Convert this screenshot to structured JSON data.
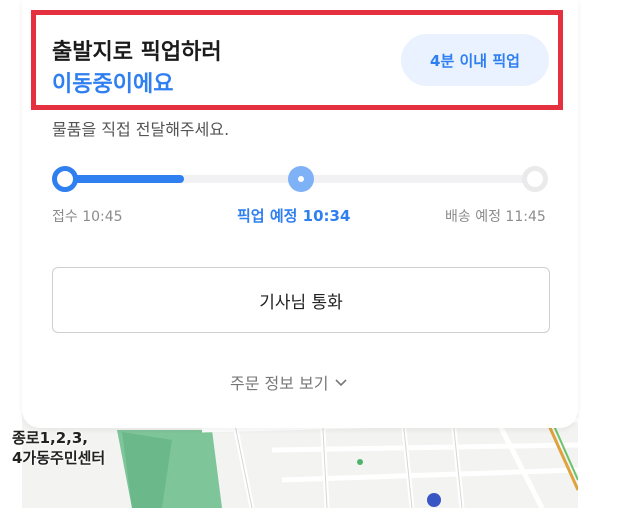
{
  "header": {
    "title_line1": "출발지로 픽업하러",
    "title_line2": "이동중이에요",
    "eta_badge": "4분 이내 픽업",
    "subtitle": "물품을 직접 전달해주세요."
  },
  "progress": {
    "steps": [
      {
        "label": "접수 10:45",
        "state": "done"
      },
      {
        "label": "픽업 예정 10:34",
        "state": "current"
      },
      {
        "label": "배송 예정 11:45",
        "state": "pending"
      }
    ]
  },
  "actions": {
    "call_driver": "기사님 통화",
    "order_info": "주문 정보 보기"
  },
  "map": {
    "place_label_line1": "종로1,2,3,",
    "place_label_line2": "4가동주민센터",
    "partial_label": "●"
  },
  "colors": {
    "accent": "#2f7ff1",
    "highlight_frame": "#e5303f"
  }
}
